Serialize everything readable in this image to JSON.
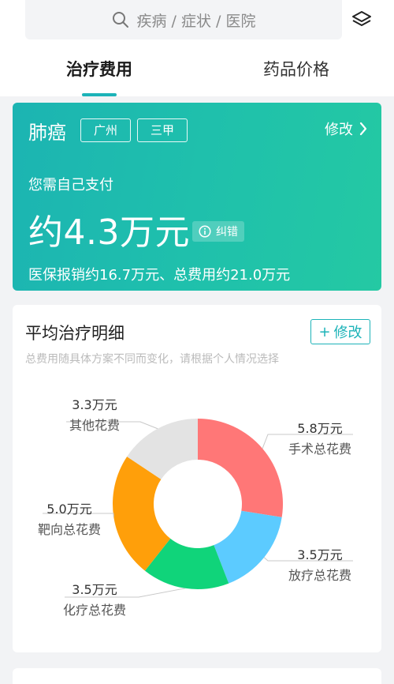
{
  "search": {
    "placeholder": "疾病 / 症状 / 医院"
  },
  "tabs": [
    {
      "label": "治疗费用"
    },
    {
      "label": "药品价格"
    }
  ],
  "summary": {
    "disease": "肺癌",
    "city_tag": "广州",
    "level_tag": "三甲",
    "modify_label": "修改",
    "pay_label": "您需自己支付",
    "pay_amount": "约4.3万元",
    "correct_label": "纠错",
    "insurance_text": "医保报销约16.7万元、总费用约21.0万元"
  },
  "detail": {
    "title": "平均治疗明细",
    "modify_label": "修改",
    "subtitle": "总费用随具体方案不同而变化，请根据个人情况选择"
  },
  "colors": {
    "accent": "#1cb3b8",
    "surgery": "#ff7777",
    "radio": "#5ccbff",
    "chemo": "#10d47a",
    "targeted": "#ff9f0a",
    "other": "#e3e3e3"
  },
  "chart_data": {
    "type": "pie",
    "unit": "万元",
    "slices": [
      {
        "label": "手术总花费",
        "value": 5.8,
        "value_label": "5.8万元",
        "color": "#ff7777"
      },
      {
        "label": "放疗总花费",
        "value": 3.5,
        "value_label": "3.5万元",
        "color": "#5ccbff"
      },
      {
        "label": "化疗总花费",
        "value": 3.5,
        "value_label": "3.5万元",
        "color": "#10d47a"
      },
      {
        "label": "靶向总花费",
        "value": 5.0,
        "value_label": "5.0万元",
        "color": "#ff9f0a"
      },
      {
        "label": "其他花费",
        "value": 3.3,
        "value_label": "3.3万元",
        "color": "#e3e3e3"
      }
    ]
  }
}
